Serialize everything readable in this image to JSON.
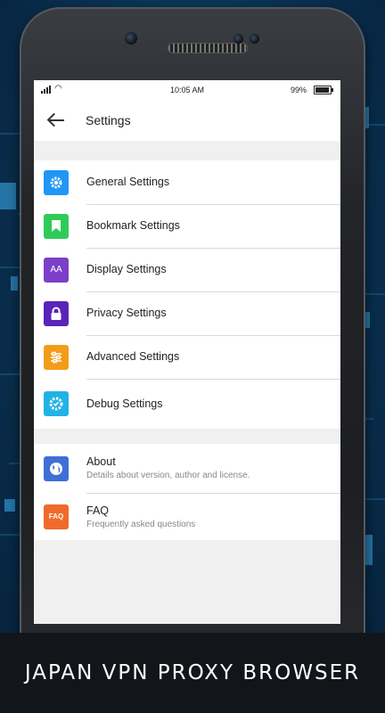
{
  "status": {
    "time": "10:05 AM",
    "battery": "99%"
  },
  "appbar": {
    "title": "Settings"
  },
  "settings": [
    {
      "label": "General Settings",
      "icon": "gear-icon",
      "color": "#2196f3"
    },
    {
      "label": "Bookmark Settings",
      "icon": "bookmark-icon",
      "color": "#2ecc57"
    },
    {
      "label": "Display Settings",
      "icon": "font-size-icon",
      "color": "#7b3fc9"
    },
    {
      "label": "Privacy Settings",
      "icon": "lock-icon",
      "color": "#5a24b8"
    },
    {
      "label": "Advanced Settings",
      "icon": "sliders-icon",
      "color": "#f39c1a"
    },
    {
      "label": "Debug Settings",
      "icon": "debug-gear-icon",
      "color": "#21b3e6"
    }
  ],
  "info": [
    {
      "label": "About",
      "sub": "Details about version, author and license.",
      "icon": "globe-icon",
      "color": "#3f6fd6"
    },
    {
      "label": "FAQ",
      "sub": "Frequently asked questions",
      "icon": "faq-icon",
      "icon_text": "FAQ",
      "color": "#f06b2a"
    }
  ],
  "banner": {
    "text": "JAPAN VPN PROXY BROWSER"
  },
  "display_icon_text": "AA"
}
